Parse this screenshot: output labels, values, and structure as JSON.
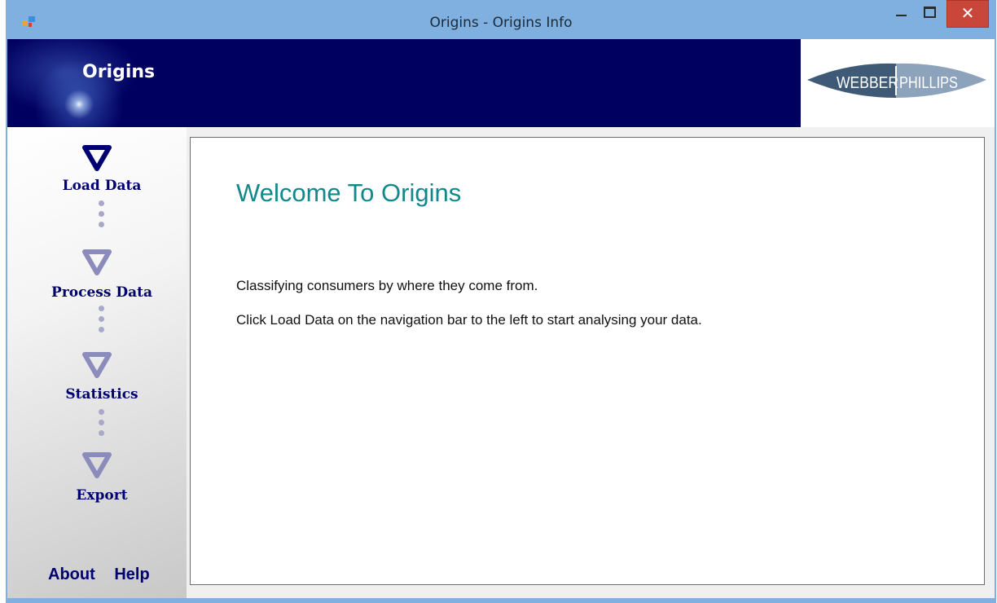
{
  "window": {
    "title": "Origins - Origins Info",
    "close_glyph": "✕"
  },
  "header": {
    "title": "Origins",
    "logo_text_left": "WEBBER",
    "logo_text_right": "PHILLIPS"
  },
  "sidebar": {
    "steps": [
      {
        "label": "Load Data",
        "state": "active"
      },
      {
        "label": "Process Data",
        "state": "inactive"
      },
      {
        "label": "Statistics",
        "state": "inactive"
      },
      {
        "label": "Export",
        "state": "inactive"
      }
    ],
    "about_label": "About",
    "help_label": "Help"
  },
  "content": {
    "heading": "Welcome To Origins",
    "line1": "Classifying consumers by where they come from.",
    "line2": "Click Load Data on the navigation bar to the left to start analysing your data."
  },
  "colors": {
    "header_bg": "#000060",
    "nav_text": "#000070",
    "heading": "#12888a",
    "titlebar": "#7fb0e0",
    "close_button": "#c9463a"
  }
}
